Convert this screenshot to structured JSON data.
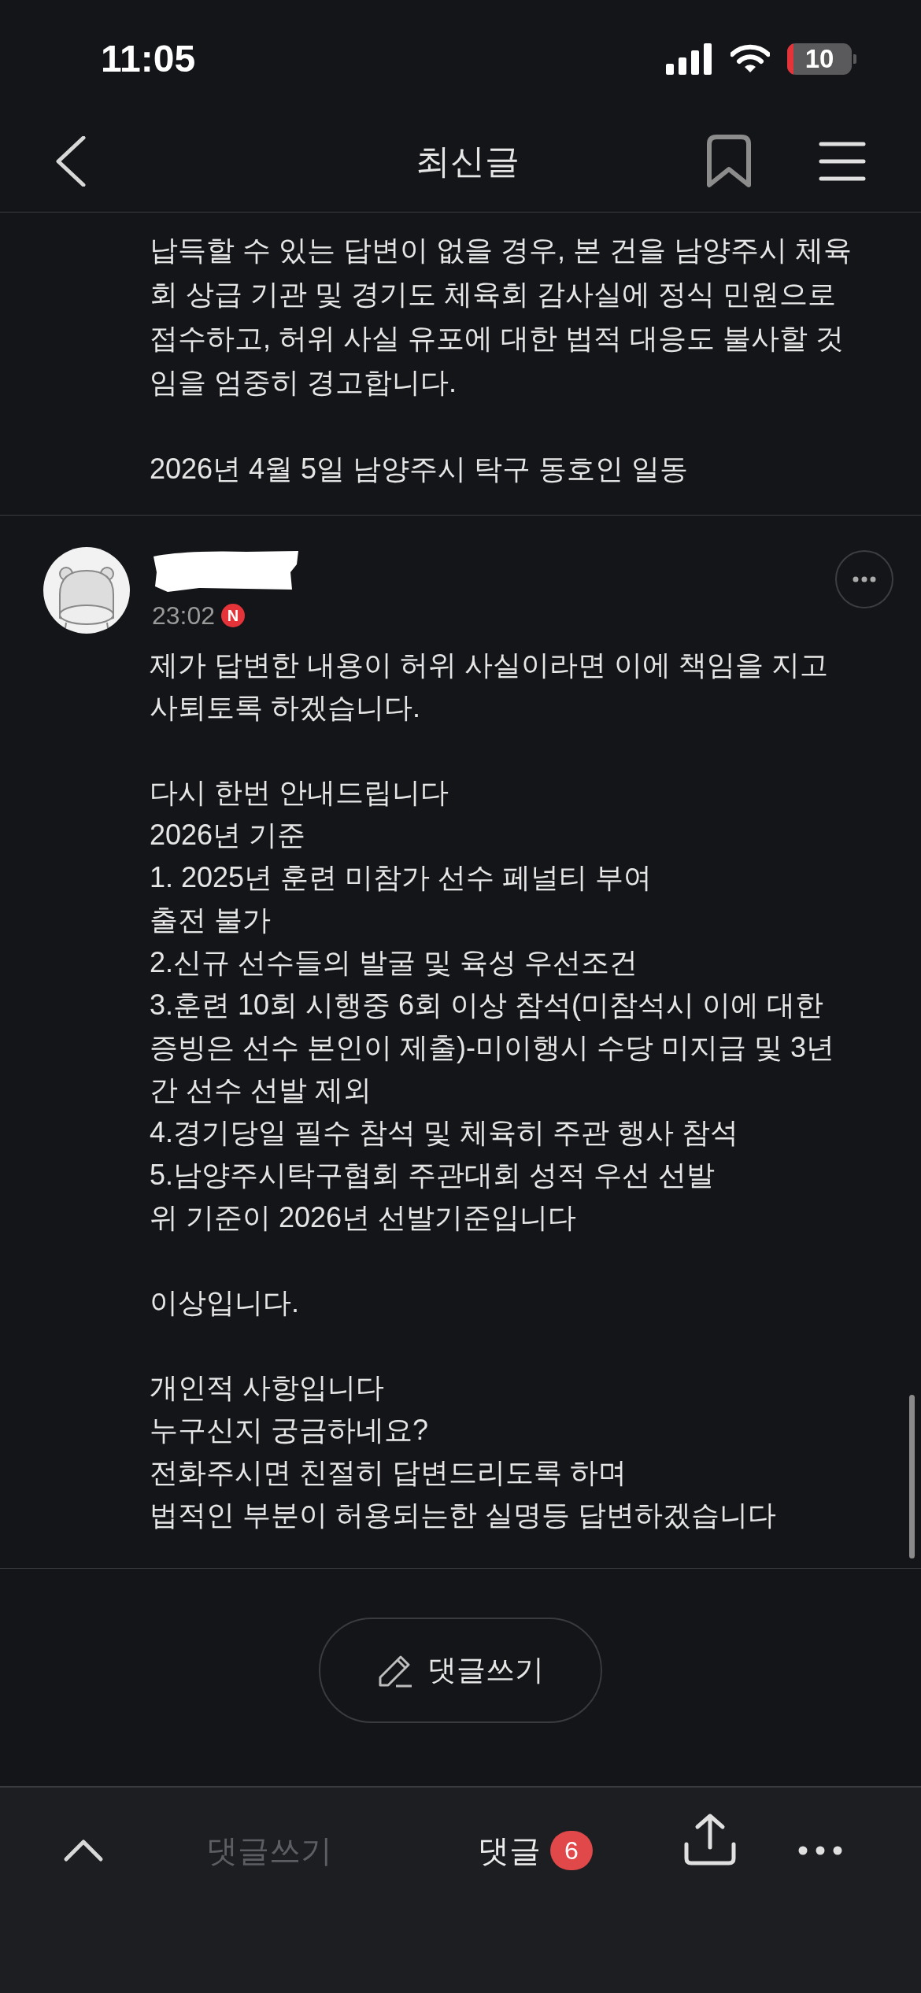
{
  "status_bar": {
    "time": "11:05",
    "battery": "10"
  },
  "nav": {
    "title": "최신글"
  },
  "post": {
    "paragraphs": [
      "납득할 수 있는 답변이 없을 경우, 본 건을 남양주시 체육회 상급 기관 및 경기도 체육회 감사실에 정식 민원으로 접수하고, 허위 사실 유포에 대한 법적 대응도 불사할 것임을 엄중히 경고합니다.",
      "2026년 4월 5일 남양주시 탁구 동호인 일동"
    ]
  },
  "comment": {
    "time": "23:02",
    "new_badge": "N",
    "body": "제가 답변한 내용이 허위 사실이라면 이에 책임을 지고 사퇴토록 하겠습니다.\n\n다시 한번 안내드립니다\n2026년 기준\n1. 2025년 훈련 미참가 선수 페널티 부여\n출전 불가\n2.신규 선수들의 발굴 및 육성 우선조건\n3.훈련 10회 시행중 6회 이상 참석(미참석시 이에 대한 증빙은 선수 본인이 제출)-미이행시 수당 미지급 및 3년간 선수 선발 제외\n4.경기당일 필수 참석 및 체육히 주관 행사 참석\n5.남양주시탁구협회 주관대회 성적 우선 선발\n위 기준이 2026년 선발기준입니다\n\n이상입니다.\n\n개인적 사항입니다\n누구신지 궁금하네요?\n전화주시면 친절히 답변드리도록 하며\n법적인 부분이 허용되는한 실명등 답변하겠습니다"
  },
  "write_button": {
    "label": "댓글쓰기"
  },
  "bottom_bar": {
    "write": {
      "label": "댓글쓰기",
      "disabled": true
    },
    "comments": {
      "label": "댓글",
      "count": "6"
    }
  }
}
